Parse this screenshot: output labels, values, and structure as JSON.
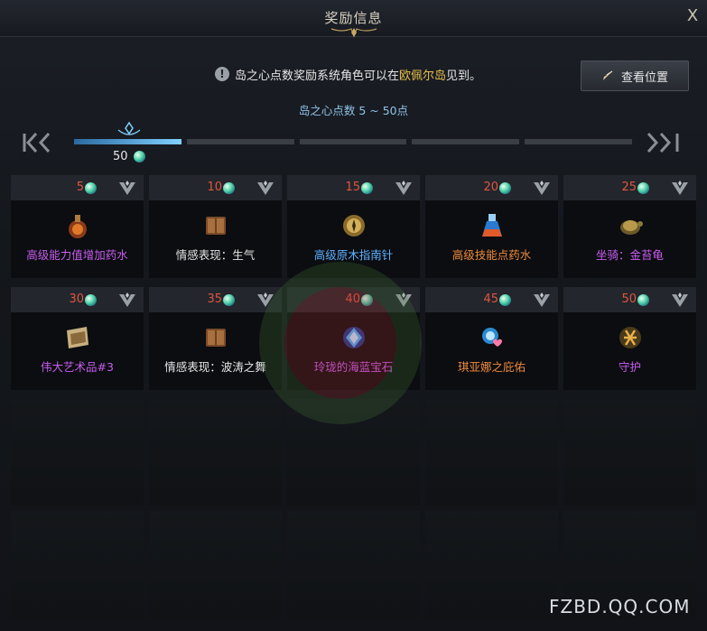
{
  "window": {
    "title": "奖励信息",
    "close_label": "X"
  },
  "notice": {
    "prefix": "岛之心点数奖励系统角色可以在",
    "highlight": "欧佩尔岛",
    "suffix": "见到。",
    "icon": "info-icon"
  },
  "location_button": {
    "label": "查看位置",
    "icon": "compass-icon"
  },
  "range_label": "岛之心点数 5 ~ 50点",
  "progress": {
    "value_label": "50",
    "segments_total": 5,
    "segments_filled": 1,
    "fill_fraction": 0.2
  },
  "colors": {
    "reward_count": "#e0553f",
    "purple_item": "#c85cf0",
    "blue_item": "#5fb0ff",
    "orange_item": "#f08a3c",
    "white_item": "#e6e6e6",
    "progress_fill": "#7fd0ff"
  },
  "rewards": [
    {
      "points": "5",
      "name": "高级能力值增加药水",
      "grade": "purple",
      "icon": "potion-icon"
    },
    {
      "points": "10",
      "name": "情感表现：生气",
      "grade": "white",
      "icon": "book-icon"
    },
    {
      "points": "15",
      "name": "高级原木指南针",
      "grade": "blue",
      "icon": "compass-item-icon"
    },
    {
      "points": "20",
      "name": "高级技能点药水",
      "grade": "orange",
      "icon": "flask-icon"
    },
    {
      "points": "25",
      "name": "坐骑：金苔龟",
      "grade": "purple",
      "icon": "turtle-mount-icon"
    },
    {
      "points": "30",
      "name": "伟大艺术品#3",
      "grade": "purple",
      "icon": "painting-icon"
    },
    {
      "points": "35",
      "name": "情感表现：波涛之舞",
      "grade": "white",
      "icon": "book-icon"
    },
    {
      "points": "40",
      "name": "玲珑的海蓝宝石",
      "grade": "purple",
      "icon": "gem-icon"
    },
    {
      "points": "45",
      "name": "琪亚娜之庇佑",
      "grade": "orange",
      "icon": "blessing-icon"
    },
    {
      "points": "50",
      "name": "守护",
      "grade": "purple",
      "icon": "rune-icon"
    }
  ],
  "watermark": "FZBD.QQ.COM"
}
